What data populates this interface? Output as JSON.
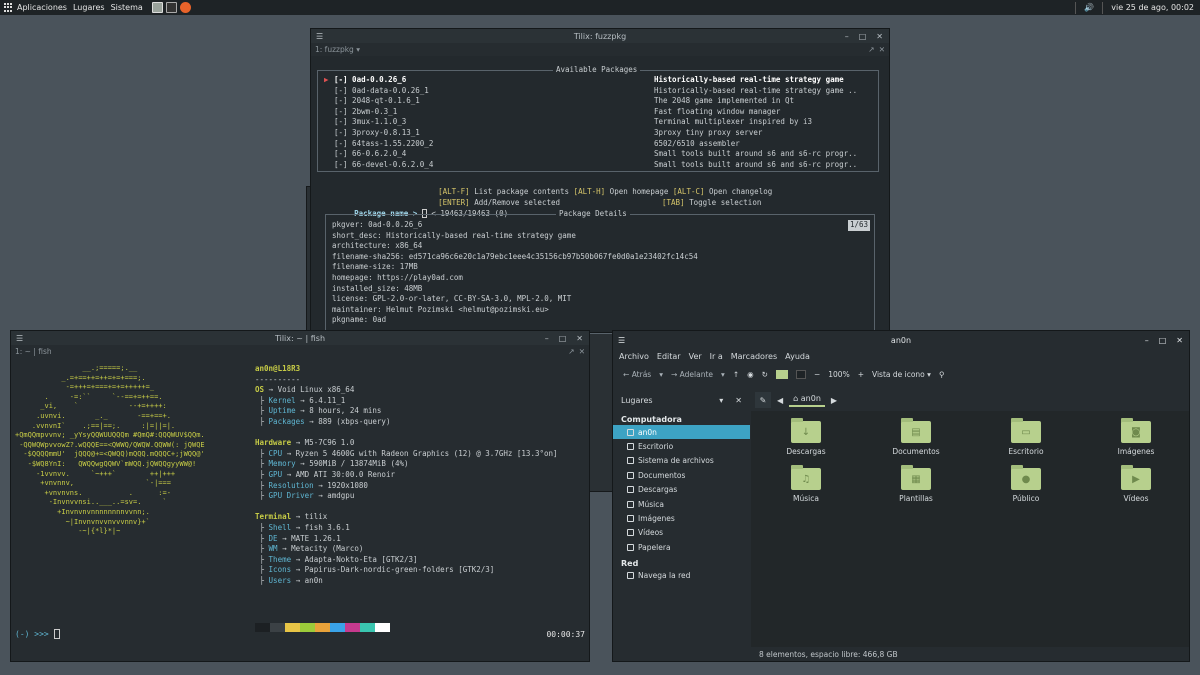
{
  "panel": {
    "menu": [
      "Aplicaciones",
      "Lugares",
      "Sistema"
    ],
    "clock": "vie 25 de ago, 00:02",
    "icons": [
      "apps-grid-icon",
      "terminal-launcher-icon",
      "files-launcher-icon",
      "firefox-icon",
      "volume-icon",
      "power-icon"
    ]
  },
  "fuzz": {
    "title": "Tilix: fuzzpkg",
    "tab": "1: fuzzpkg",
    "available_title": "Available Packages",
    "packages": [
      {
        "sel": "[-]",
        "name": "0ad-0.0.26_6",
        "desc": "Historically-based real-time strategy game"
      },
      {
        "sel": "[-]",
        "name": "0ad-data-0.0.26_1",
        "desc": "Historically-based real-time strategy game .."
      },
      {
        "sel": "[-]",
        "name": "2048-qt-0.1.6_1",
        "desc": "The 2048 game implemented in Qt"
      },
      {
        "sel": "[-]",
        "name": "2bwm-0.3_1",
        "desc": "Fast floating window manager"
      },
      {
        "sel": "[-]",
        "name": "3mux-1.1.0_3",
        "desc": "Terminal multiplexer inspired by i3"
      },
      {
        "sel": "[-]",
        "name": "3proxy-0.8.13_1",
        "desc": "3proxy tiny proxy server"
      },
      {
        "sel": "[-]",
        "name": "64tass-1.55.2200_2",
        "desc": "6502/6510 assembler"
      },
      {
        "sel": "[-]",
        "name": "66-0.6.2.0_4",
        "desc": "Small tools built around s6 and s6-rc progr.."
      },
      {
        "sel": "[-]",
        "name": "66-devel-0.6.2.0_4",
        "desc": "Small tools built around s6 and s6-rc progr.."
      }
    ],
    "help_1": [
      "[ALT-F]",
      " List package contents ",
      "[ALT-H]",
      " Open homepage ",
      "[ALT-C]",
      " Open changelog"
    ],
    "help_2": [
      "[ENTER]",
      " Add/Remove selected",
      "[TAB]",
      " Toggle selection"
    ],
    "search_label": "Package name > ",
    "count": "< 19463/19463 (0)",
    "details_title": "Package Details",
    "details_page": "1/63",
    "details": [
      "pkgver: 0ad-0.0.26_6",
      "short_desc: Historically-based real-time strategy game",
      "architecture: x86_64",
      "filename-sha256: ed571ca96c6e20c1a79ebc1eee4c35156cb97b50b067fe0d0a1e23402fc14c54",
      "filename-size: 17MB",
      "homepage: https://play0ad.com",
      "installed_size: 48MB",
      "license: GPL-2.0-or-later, CC-BY-SA-3.0, MPL-2.0, MIT",
      "maintainer: Helmut Pozimski <helmut@pozimski.eu>",
      "pkgname: 0ad"
    ]
  },
  "fish": {
    "title": "Tilix: ~ | fish",
    "tab": "1: ~ | fish",
    "art": [
      "                __.;=====;.__",
      "           _.=+==++=++=+=+===;.",
      "            -=+++=+===+=+=+++++=_",
      "       .     -=:``     `--==+=++==.",
      "      _vi,    `            --+=++++:",
      "     .uvnvi.       _._       -==+==+.",
      "    .vvnvnI`    .;==|==;.     :|=||=|.",
      "+QmQQmpvvnv; _yYsyQQWUUQQQm #QmQ#:QQQWUV$QQm.",
      " -QQWQWpvvowZ?.wQQQE==<QWWQ/QWQW.QQWW(: jQWQE",
      "  -$QQQQmmU'  jQQQ@+=<QWQQ)mQQQ.mQQQC+;jWQQ@'",
      "   -$WQ8YnI:   QWQQwgQQWV`mWQQ.jQWQQgyyWW@!",
      "     -1vvnvv.     `~+++`        ++|+++",
      "      +vnvnnv,                 `-|===",
      "       +vnvnvns.           .      :=-",
      "        -Invnvvnsi..___..=sv=.     `",
      "          +Invnvnvnnnnnnnnvvnn;.",
      "            ~|Invnvnvvnvvvnnv}+`",
      "               -~|{*l}*|~"
    ],
    "user": "an0n@L18R3",
    "sep": "----------",
    "sections": [
      {
        "title": "OS",
        "value": "Void Linux x86_64",
        "rows": [
          {
            "k": "Kernel",
            "v": "6.4.11_1"
          },
          {
            "k": "Uptime",
            "v": "8 hours, 24 mins"
          },
          {
            "k": "Packages",
            "v": "889 (xbps-query)"
          }
        ]
      },
      {
        "title": "Hardware",
        "value": "M5-7C96 1.0",
        "rows": [
          {
            "k": "CPU",
            "v": "Ryzen 5 4600G with Radeon Graphics (12) @ 3.7GHz [13.3°on]"
          },
          {
            "k": "Memory",
            "v": "590MiB / 13874MiB (4%)"
          },
          {
            "k": "GPU",
            "v": "AMD ATI 30:00.0 Renoir"
          },
          {
            "k": "Resolution",
            "v": "1920x1080"
          },
          {
            "k": "GPU Driver",
            "v": "amdgpu"
          }
        ]
      },
      {
        "title": "Terminal",
        "value": "tilix",
        "rows": [
          {
            "k": "Shell",
            "v": "fish 3.6.1"
          },
          {
            "k": "DE",
            "v": "MATE 1.26.1"
          },
          {
            "k": "WM",
            "v": "Metacity (Marco)"
          },
          {
            "k": "Theme",
            "v": "Adapta-Nokto-Eta [GTK2/3]"
          },
          {
            "k": "Icons",
            "v": "Papirus-Dark-nordic-green-folders [GTK2/3]"
          },
          {
            "k": "Users",
            "v": "an0n"
          }
        ]
      }
    ],
    "swatches": [
      "#1c2023",
      "#3b4145",
      "#e8c546",
      "#9ccb3a",
      "#e8a23a",
      "#3aa3e8",
      "#c63a8e",
      "#3ac6b0",
      "#ffffff"
    ],
    "prompt": "(-) >>>",
    "clock": "00:00:37"
  },
  "fm": {
    "title": "an0n",
    "menu": [
      "Archivo",
      "Editar",
      "Ver",
      "Ir a",
      "Marcadores",
      "Ayuda"
    ],
    "back": "Atrás",
    "forward": "Adelante",
    "zoom": "100%",
    "view": "Vista de icono",
    "places": "Lugares",
    "sections": [
      {
        "title": "Computadora",
        "items": [
          "an0n",
          "Escritorio",
          "Sistema de archivos",
          "Documentos",
          "Descargas",
          "Música",
          "Imágenes",
          "Vídeos",
          "Papelera"
        ]
      },
      {
        "title": "Red",
        "items": [
          "Navega la red"
        ]
      }
    ],
    "active": "an0n",
    "crumb": "an0n",
    "folders": [
      {
        "name": "Descargas",
        "glyph": "↓"
      },
      {
        "name": "Documentos",
        "glyph": "▤"
      },
      {
        "name": "Escritorio",
        "glyph": "▭"
      },
      {
        "name": "Imágenes",
        "glyph": "◙"
      },
      {
        "name": "Música",
        "glyph": "♫"
      },
      {
        "name": "Plantillas",
        "glyph": "▦"
      },
      {
        "name": "Público",
        "glyph": "●"
      },
      {
        "name": "Vídeos",
        "glyph": "▶"
      }
    ],
    "status": "8 elementos, espacio libre: 466,8 GB"
  }
}
